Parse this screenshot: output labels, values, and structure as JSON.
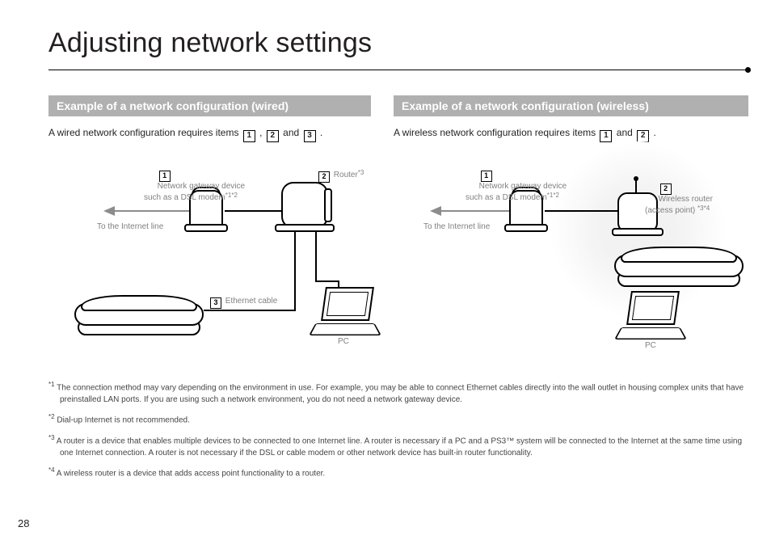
{
  "page": {
    "title": "Adjusting network settings",
    "number": "28"
  },
  "wired": {
    "heading": "Example of a network configuration (wired)",
    "intro_pre": "A wired network configuration requires items ",
    "intro_mid1": ", ",
    "intro_mid2": " and ",
    "intro_post": ".",
    "items": [
      "1",
      "2",
      "3"
    ],
    "label_gateway": "Network gateway device\nsuch as a DSL modem",
    "label_gateway_sup": "*1*2",
    "label_router": "Router",
    "label_router_sup": "*3",
    "label_ethernet": "Ethernet cable",
    "label_internet": "To the Internet line",
    "label_pc": "PC"
  },
  "wireless": {
    "heading": "Example of a network configuration (wireless)",
    "intro_pre": "A wireless network configuration requires items ",
    "intro_mid": " and ",
    "intro_post": ".",
    "items": [
      "1",
      "2"
    ],
    "label_gateway": "Network gateway device\nsuch as a DSL modem",
    "label_gateway_sup": "*1*2",
    "label_wrouter": "Wireless router\n(access point) ",
    "label_wrouter_sup": "*3*4",
    "label_internet": "To the Internet line",
    "label_pc": "PC"
  },
  "footnotes": {
    "f1_sup": "*1",
    "f1": " The connection method may vary depending on the environment in use. For example, you may be able to connect Ethernet cables directly into the wall outlet in housing complex units that have preinstalled LAN ports. If you are using such a network environment, you do not need a network gateway device.",
    "f2_sup": "*2",
    "f2": " Dial-up Internet is not recommended.",
    "f3_sup": "*3",
    "f3": " A router is a device that enables multiple devices to be connected to one Internet line. A router is necessary if a PC and a PS3™ system will be connected to the Internet at the same time using one Internet connection. A router is not necessary if the DSL or cable modem or other network device has built-in router functionality.",
    "f4_sup": "*4",
    "f4": " A wireless router is a device that adds access point functionality to a router."
  }
}
